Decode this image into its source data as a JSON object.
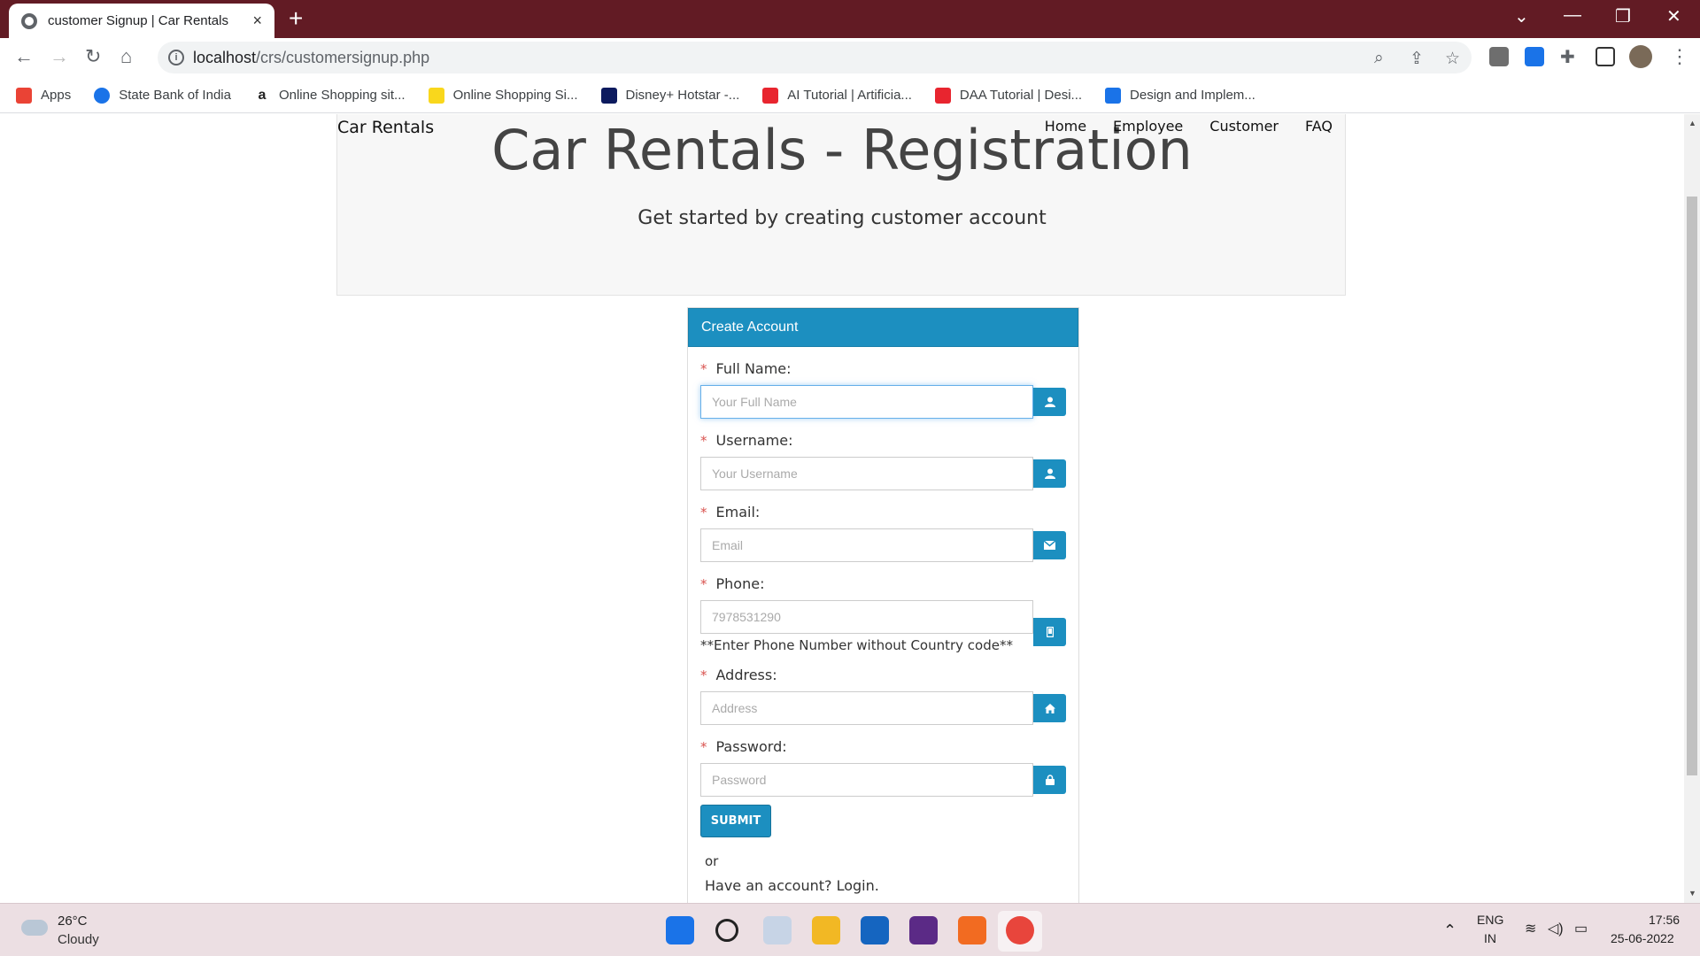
{
  "browser": {
    "tab_title": "customer Signup | Car Rentals",
    "tab_close": "×",
    "new_tab": "+",
    "url_host": "localhost",
    "url_path": "/crs/customersignup.php",
    "bookmarks": [
      {
        "label": "Apps",
        "icon_color": "#ea4335"
      },
      {
        "label": "State Bank of India",
        "icon_color": "#1a73e8"
      },
      {
        "label": "Online Shopping sit...",
        "icon_color": "#222222"
      },
      {
        "label": "Online Shopping Si...",
        "icon_color": "#f9d71c"
      },
      {
        "label": "Disney+ Hotstar -...",
        "icon_color": "#0c1a5e"
      },
      {
        "label": "AI Tutorial | Artificia...",
        "icon_color": "#e8252f"
      },
      {
        "label": "DAA Tutorial | Desi...",
        "icon_color": "#e8252f"
      },
      {
        "label": "Design and Implem...",
        "icon_color": "#1a73e8"
      }
    ]
  },
  "page": {
    "brand": "Car Rentals",
    "title": "Car Rentals - Registration",
    "subtitle": "Get started by creating customer account",
    "nav": [
      "Home",
      "Employee",
      "Customer",
      "FAQ"
    ]
  },
  "form": {
    "heading": "Create Account",
    "required_mark": "*",
    "fields": [
      {
        "label": "Full Name:",
        "placeholder": "Your Full Name",
        "icon": "user-icon"
      },
      {
        "label": "Username:",
        "placeholder": "Your Username",
        "icon": "user-icon"
      },
      {
        "label": "Email:",
        "placeholder": "Email",
        "icon": "envelope-icon"
      },
      {
        "label": "Phone:",
        "placeholder": "7978531290",
        "icon": "phone-icon"
      },
      {
        "label": "Address:",
        "placeholder": "Address",
        "icon": "home-icon"
      },
      {
        "label": "Password:",
        "placeholder": "Password",
        "icon": "lock-icon"
      }
    ],
    "phone_hint": "**Enter Phone Number without Country code**",
    "submit": "SUBMIT",
    "or": "or",
    "login_text": "Have an account? Login."
  },
  "taskbar": {
    "temp": "26°C",
    "condition": "Cloudy",
    "lang_top": "ENG",
    "lang_bottom": "IN",
    "time": "17:56",
    "date": "25-06-2022"
  },
  "colors": {
    "primary": "#1c8fc0",
    "titlebar": "#621b24"
  }
}
